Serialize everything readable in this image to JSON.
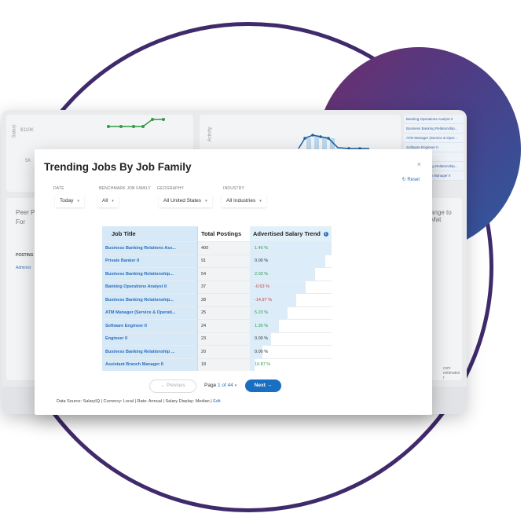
{
  "background": {
    "y_label_salary": "Salary",
    "y_label_activity": "Activity",
    "tick_110k": "$110K",
    "tick_5k": "5K",
    "peer_text_1": "Peer Po",
    "peer_text_2": "For",
    "posting_header": "POSTING T",
    "posting_row": "Administ",
    "right_text": "ange to Mat",
    "estimates_text": "com estimates r",
    "list_items": [
      "Banking Operations Analyst II",
      "Business Banking Relationship...",
      "ATM Manager (Service & Oper...",
      "Software Engineer II",
      "Engineer II",
      "Business Banking Relationship...",
      "Assistant Branch Manager II"
    ]
  },
  "modal": {
    "title": "Trending Jobs By Job Family",
    "close": "×",
    "reset": "Reset",
    "filters": [
      {
        "label": "DATE",
        "value": "Today"
      },
      {
        "label": "BENCHMARK JOB FAMILY",
        "value": "All"
      },
      {
        "label": "GEOGRAPHY",
        "value": "All United States"
      },
      {
        "label": "INDUSTRY",
        "value": "All Industries"
      }
    ],
    "table": {
      "headers": [
        "Job Title",
        "Total Postings",
        "Advertised Salary Trend"
      ],
      "rows": [
        {
          "title": "Business Banking Relations Ass...",
          "postings": "400",
          "trend": "1.46 %",
          "bar": 1.0
        },
        {
          "title": "Private Banker II",
          "postings": "91",
          "trend": "0.00 %",
          "bar": 0.92
        },
        {
          "title": "Business Banking Relationship...",
          "postings": "54",
          "trend": "2.03 %",
          "bar": 0.8
        },
        {
          "title": "Banking Operations Analyst II",
          "postings": "37",
          "trend": "-0.63 %",
          "bar": 0.68
        },
        {
          "title": "Business Banking Relationship...",
          "postings": "28",
          "trend": "-14.97 %",
          "bar": 0.57
        },
        {
          "title": "ATM Manager (Service & Operati...",
          "postings": "25",
          "trend": "5.23 %",
          "bar": 0.46
        },
        {
          "title": "Software Engineer II",
          "postings": "24",
          "trend": "1.30 %",
          "bar": 0.36
        },
        {
          "title": "Engineer II",
          "postings": "23",
          "trend": "0.00 %",
          "bar": 0.26
        },
        {
          "title": "Business Banking Relationship ...",
          "postings": "20",
          "trend": "0.00 %",
          "bar": 0.15
        },
        {
          "title": "Assistant Branch Manager II",
          "postings": "18",
          "trend": "10.87 %",
          "bar": 0.06
        }
      ]
    },
    "pagination": {
      "previous": "Previous",
      "page_prefix": "Page",
      "page_current": "1 of 44",
      "next": "Next"
    },
    "footer": {
      "text": "Data Source: SalaryIQ | Currency: Local | Rate: Annual | Salary Display: Median |",
      "edit": "Edit"
    }
  }
}
